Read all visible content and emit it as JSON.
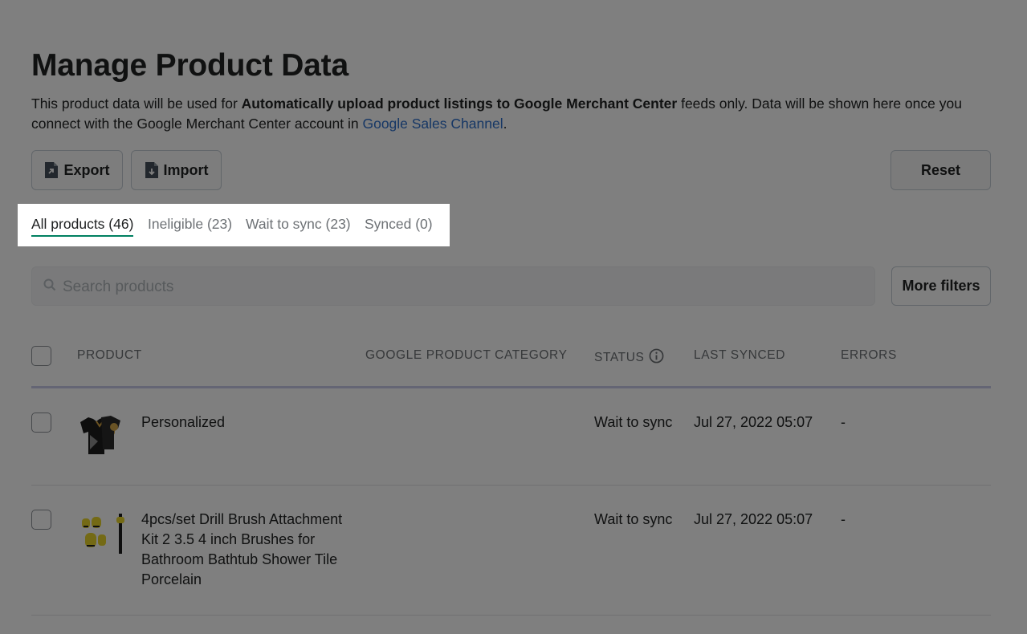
{
  "page": {
    "title": "Manage Product Data",
    "desc_part1": "This product data will be used for ",
    "desc_bold": "Automatically upload product listings to Google Merchant Center",
    "desc_part2": " feeds only. Data will be shown here once you connect with the Google Merchant Center account in ",
    "desc_link": "Google Sales Channel",
    "desc_end": "."
  },
  "toolbar": {
    "export_label": "Export",
    "import_label": "Import",
    "reset_label": "Reset",
    "export_icon": "file-export-icon",
    "import_icon": "file-import-icon"
  },
  "tabs": [
    {
      "label": "All products (46)",
      "active": true
    },
    {
      "label": "Ineligible (23)",
      "active": false
    },
    {
      "label": "Wait to sync (23)",
      "active": false
    },
    {
      "label": "Synced (0)",
      "active": false
    }
  ],
  "search": {
    "placeholder": "Search products",
    "icon": "search-icon"
  },
  "filters": {
    "more_label": "More filters"
  },
  "table": {
    "headers": [
      "Product",
      "Google product category",
      "Status",
      "Last synced",
      "Errors"
    ],
    "status_info_icon": "info-icon",
    "rows": [
      {
        "product": "Personalized",
        "category": "",
        "status": "Wait to sync",
        "last_synced": "Jul 27, 2022 05:07",
        "errors": "-",
        "thumb_icon": "polo-shirt-thumbnail"
      },
      {
        "product": "4pcs/set Drill Brush Attachment Kit 2 3.5 4 inch Brushes for Bathroom Bathtub Shower Tile Porcelain",
        "category": "",
        "status": "Wait to sync",
        "last_synced": "Jul 27, 2022 05:07",
        "errors": "-",
        "thumb_icon": "drill-brush-thumbnail"
      }
    ]
  },
  "colors": {
    "accent": "#008060",
    "link": "#2c6ecb",
    "overlay": "rgba(0,0,0,0.5)"
  }
}
